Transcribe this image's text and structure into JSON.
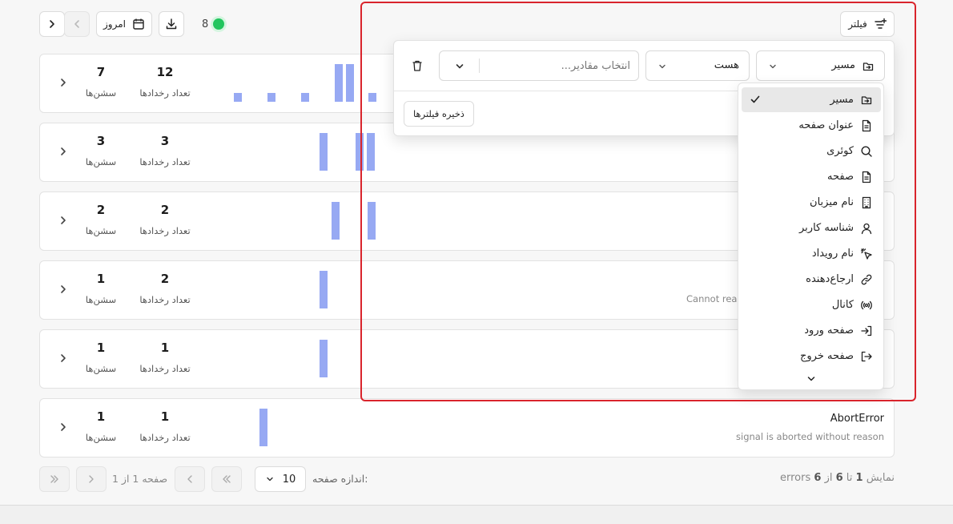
{
  "toolbar": {
    "today_label": "امروز",
    "live_count": "8",
    "filter_label": "فیلتر"
  },
  "colors": {
    "live_dot": "#22c55e",
    "bar": "#97a9f3",
    "highlight": "#d9242c"
  },
  "rows": [
    {
      "events": "12",
      "sessions": "7",
      "events_label": "تعداد رخدادها",
      "sessions_label": "سشن‌ها"
    },
    {
      "events": "3",
      "sessions": "3",
      "events_label": "تعداد رخدادها",
      "sessions_label": "سشن‌ها"
    },
    {
      "events": "2",
      "sessions": "2",
      "events_label": "تعداد رخدادها",
      "sessions_label": "سشن‌ها"
    },
    {
      "events": "2",
      "sessions": "1",
      "events_label": "تعداد رخدادها",
      "sessions_label": "سشن‌ها",
      "subtitle_partial": "Cannot read"
    },
    {
      "events": "1",
      "sessions": "1",
      "events_label": "تعداد رخدادها",
      "sessions_label": "سشن‌ها"
    },
    {
      "events": "1",
      "sessions": "1",
      "events_label": "تعداد رخدادها",
      "sessions_label": "سشن‌ها",
      "title": "AbortError",
      "subtitle": "signal is aborted without reason"
    }
  ],
  "filter_popup": {
    "property_value": "مسیر",
    "operator_value": "هست",
    "values_placeholder": "انتخاب مقادیر...",
    "save_label": "ذخیره فیلترها"
  },
  "property_menu": {
    "items": [
      {
        "label": "مسیر",
        "icon": "route-icon",
        "selected": true
      },
      {
        "label": "عنوان صفحه",
        "icon": "document-icon"
      },
      {
        "label": "کوئری",
        "icon": "search-icon"
      },
      {
        "label": "صفحه",
        "icon": "file-icon"
      },
      {
        "label": "نام میزبان",
        "icon": "building-icon"
      },
      {
        "label": "شناسه کاربر",
        "icon": "user-icon"
      },
      {
        "label": "نام رویداد",
        "icon": "click-icon"
      },
      {
        "label": "ارجاع‌دهنده",
        "icon": "link-icon"
      },
      {
        "label": "کانال",
        "icon": "broadcast-icon"
      },
      {
        "label": "صفحه ورود",
        "icon": "log-in-icon"
      },
      {
        "label": "صفحه خروج",
        "icon": "log-out-icon"
      }
    ]
  },
  "pagination": {
    "page_label": "صفحه 1 از 1",
    "page_size_label": "اندازه صفحه:",
    "page_size_value": "10",
    "summary_prefix": "نمایش",
    "summary_from": "1",
    "summary_to_word": "تا",
    "summary_to": "6",
    "summary_of_word": "از",
    "summary_total": "6",
    "summary_unit": "errors"
  }
}
